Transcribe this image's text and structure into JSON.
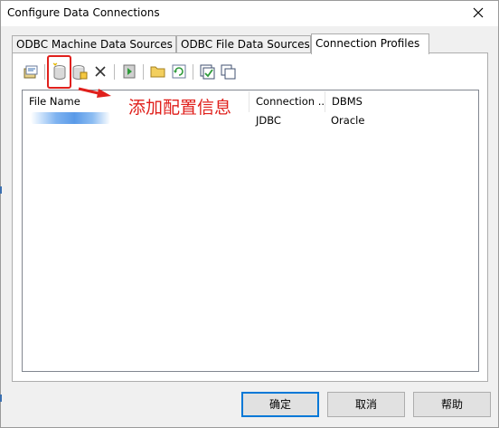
{
  "window": {
    "title": "Configure Data Connections"
  },
  "tabs": [
    {
      "label": "ODBC Machine Data Sources",
      "active": false
    },
    {
      "label": "ODBC File Data Sources",
      "active": false
    },
    {
      "label": "Connection Profiles",
      "active": true
    }
  ],
  "toolbar": {
    "icons": [
      "connect-icon",
      "add-profile-icon",
      "edit-profile-icon",
      "delete-icon",
      "test-icon",
      "open-folder-icon",
      "refresh-icon",
      "select-all-icon",
      "copy-icon"
    ]
  },
  "list": {
    "columns": [
      "File Name",
      "Connection ...",
      "DBMS"
    ],
    "rows": [
      {
        "file_name": "",
        "connection": "JDBC",
        "dbms": "Oracle"
      }
    ]
  },
  "annotation": {
    "text": "添加配置信息",
    "color": "#e0201c"
  },
  "buttons": {
    "ok": "确定",
    "cancel": "取消",
    "help": "帮助"
  },
  "colors": {
    "accent": "#0078d7",
    "highlight": "#e0201c"
  }
}
